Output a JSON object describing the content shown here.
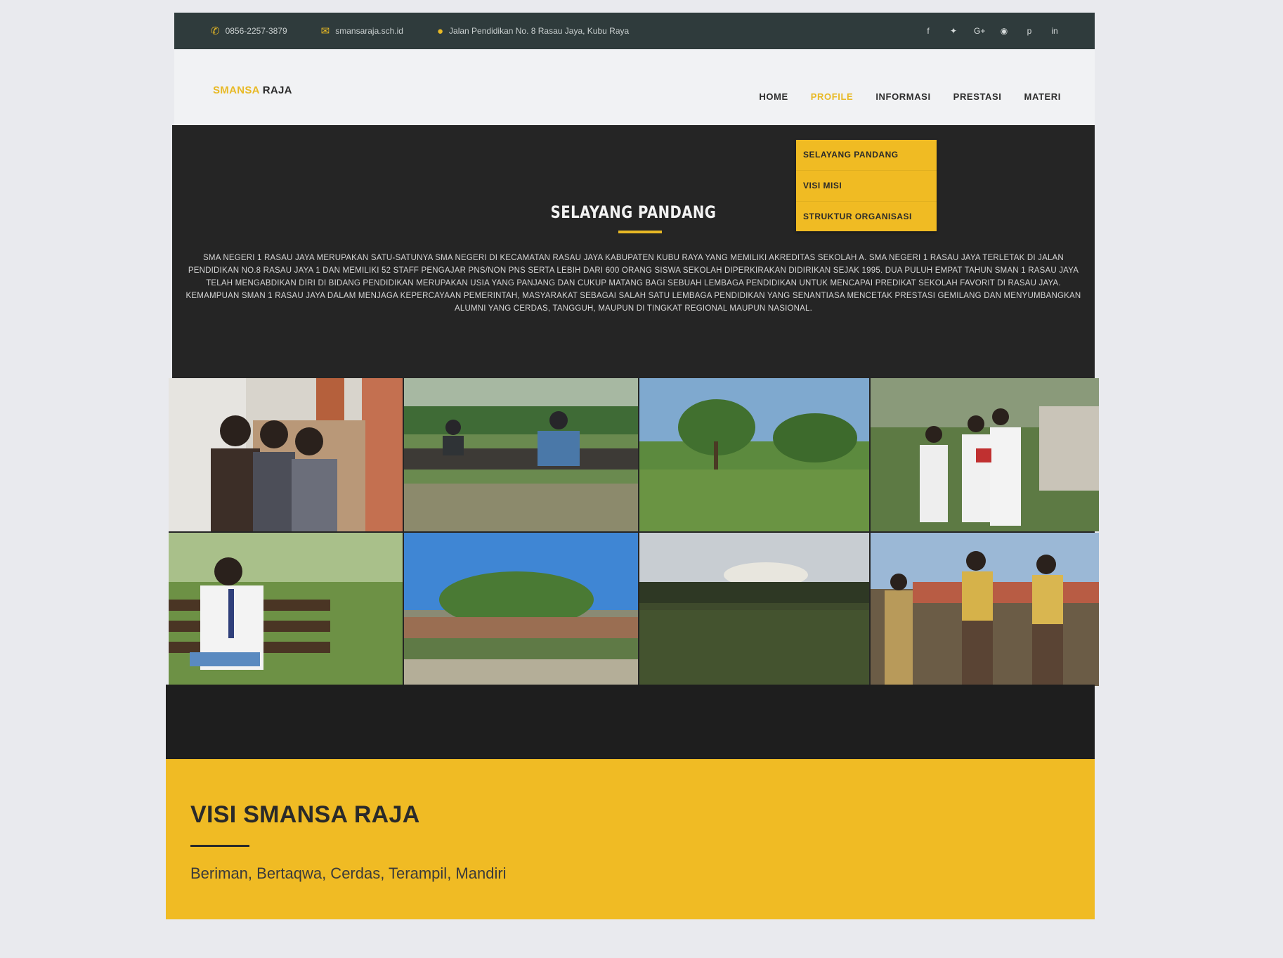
{
  "topbar": {
    "phone": "0856-2257-3879",
    "email": "smansaraja.sch.id",
    "address": "Jalan Pendidikan No. 8 Rasau Jaya, Kubu Raya",
    "social_icons": [
      "facebook-icon",
      "twitter-icon",
      "google-plus-icon",
      "instagram-icon",
      "pinterest-icon",
      "linkedin-icon"
    ]
  },
  "logo": {
    "part1": "SMANSA",
    "part2": "RAJA"
  },
  "nav": {
    "items": [
      {
        "label": "HOME"
      },
      {
        "label": "PROFILE",
        "active": true
      },
      {
        "label": "INFORMASI"
      },
      {
        "label": "PRESTASI"
      },
      {
        "label": "MATERI"
      }
    ]
  },
  "dropdown": {
    "items": [
      {
        "label": "SELAYANG PANDANG"
      },
      {
        "label": "VISI MISI"
      },
      {
        "label": "STRUKTUR ORGANISASI"
      }
    ]
  },
  "selayang": {
    "title": "SELAYANG PANDANG",
    "text": "SMA NEGERI 1 RASAU JAYA MERUPAKAN SATU-SATUNYA SMA NEGERI DI KECAMATAN RASAU JAYA KABUPATEN KUBU RAYA YANG MEMILIKI AKREDITAS SEKOLAH A. SMA NEGERI 1 RASAU JAYA TERLETAK DI JALAN PENDIDIKAN NO.8 RASAU JAYA 1 DAN MEMILIKI 52 STAFF PENGAJAR PNS/NON PNS SERTA LEBIH DARI 600 ORANG SISWA SEKOLAH DIPERKIRAKAN DIDIRIKAN SEJAK 1995. DUA PULUH EMPAT TAHUN SMAN 1 RASAU JAYA TELAH MENGABDIKAN DIRI DI BIDANG PENDIDIKAN MERUPAKAN USIA YANG PANJANG DAN CUKUP MATANG BAGI SEBUAH LEMBAGA PENDIDIKAN UNTUK MENCAPAI PREDIKAT SEKOLAH FAVORIT DI RASAU JAYA. KEMAMPUAN SMAN 1 RASAU JAYA DALAM MENJAGA KEPERCAYAAN PEMERINTAH, MASYARAKAT SEBAGAI SALAH SATU LEMBAGA PENDIDIKAN YANG SENANTIASA MENCETAK PRESTASI GEMILANG DAN MENYUMBANGKAN ALUMNI YANG CERDAS, TANGGUH, MAUPUN DI TINGKAT REGIONAL MAUPUN NASIONAL."
  },
  "gallery": {
    "photos": [
      {
        "name": "photo-students-hallway"
      },
      {
        "name": "photo-students-garden"
      },
      {
        "name": "photo-trees-field"
      },
      {
        "name": "photo-students-planting"
      },
      {
        "name": "photo-student-reading-bench"
      },
      {
        "name": "photo-school-yard-palms"
      },
      {
        "name": "photo-field-sunset"
      },
      {
        "name": "photo-students-group-uniform"
      }
    ]
  },
  "visi": {
    "title": "VISI SMANSA RAJA",
    "statement": "Beriman, Bertaqwa, Cerdas, Terampil, Mandiri"
  },
  "colors": {
    "accent": "#f0bb24",
    "dark": "#252525",
    "topbar": "#2f3b3c"
  }
}
